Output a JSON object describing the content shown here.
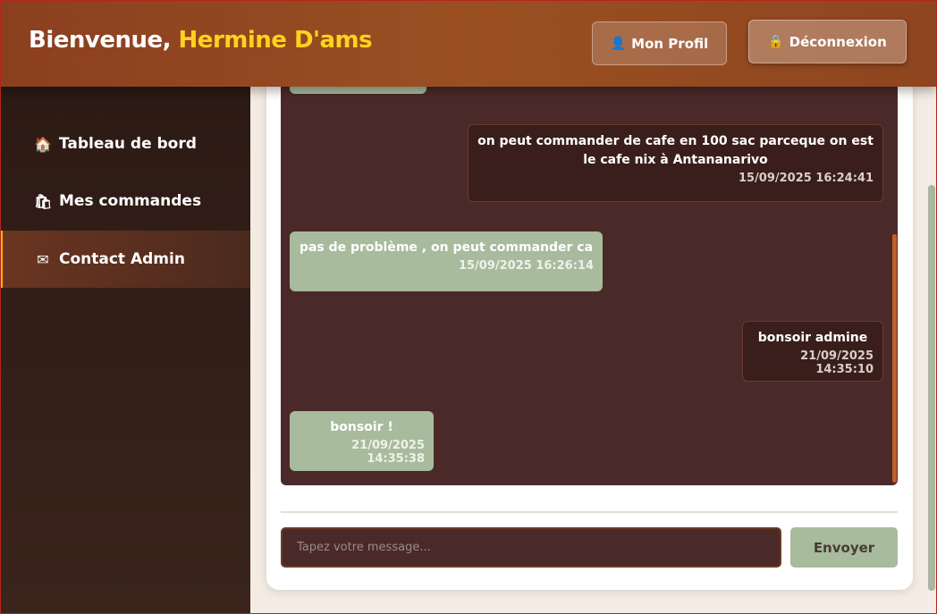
{
  "header": {
    "welcome_prefix": "Bienvenue, ",
    "user_name": "Hermine D'ams",
    "profile_icon": "👤",
    "profile_label": "Mon Profil",
    "logout_icon": "🔒",
    "logout_label": "Déconnexion"
  },
  "sidebar": {
    "items": [
      {
        "icon": "🏠",
        "label": "Tableau de bord",
        "active": false
      },
      {
        "icon": "🛍",
        "label": "Mes commandes",
        "active": false
      },
      {
        "icon": "✉",
        "label": "Contact Admin",
        "active": true
      }
    ]
  },
  "chat": {
    "messages": [
      {
        "from": "user",
        "text": "on peut commander de cafe en 100 sac parceque on est le cafe nix à Antananarivo",
        "time": "15/09/2025 16:24:41"
      },
      {
        "from": "admin",
        "text": "pas de problème , on peut commander ca",
        "time": "15/09/2025 16:26:14"
      },
      {
        "from": "user",
        "text": "bonsoir admine",
        "time": "21/09/2025 14:35:10"
      },
      {
        "from": "admin",
        "text": "bonsoir !",
        "time": "21/09/2025 14:35:38"
      }
    ],
    "input_placeholder": "Tapez votre message...",
    "input_value": "",
    "send_label": "Envoyer"
  },
  "colors": {
    "header_brown": "#9a4f22",
    "accent_yellow": "#ffd21f",
    "chat_bg": "#4a2a28",
    "admin_bubble": "#a8bb9d",
    "user_bubble": "#3a1e1c"
  }
}
